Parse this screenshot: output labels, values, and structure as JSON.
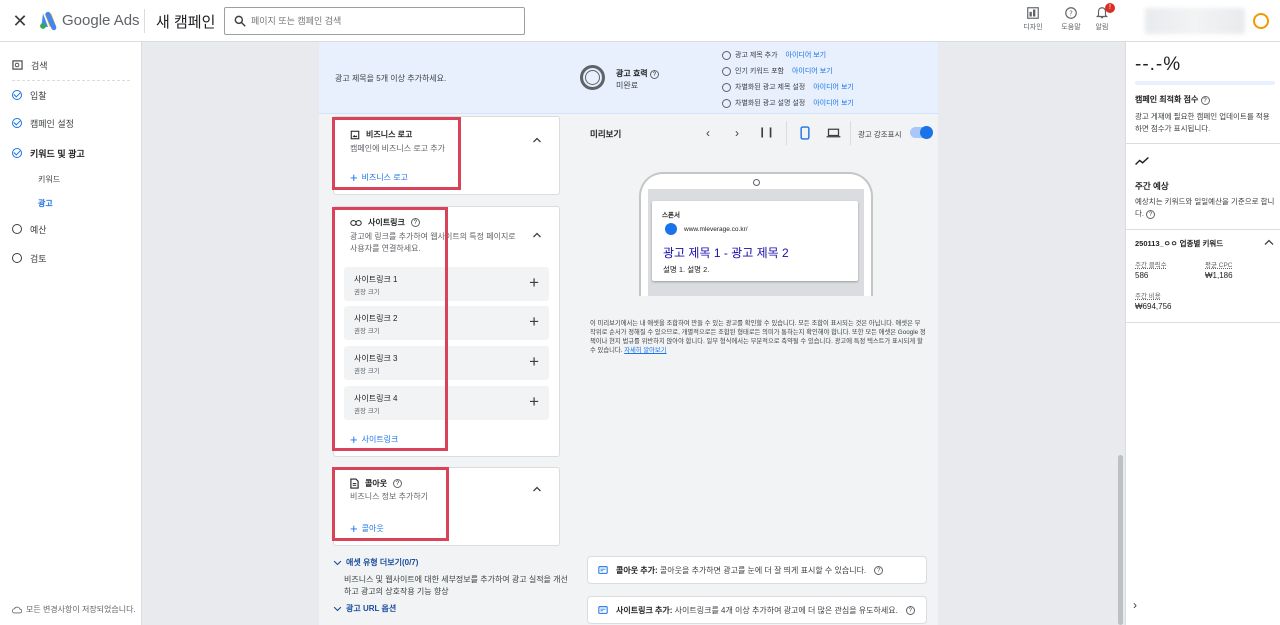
{
  "topbar": {
    "brand": "Google Ads",
    "campaign_title": "새 캠페인",
    "search_placeholder": "페이지 또는 캠페인 검색",
    "design_label": "디자인",
    "help_label": "도움말",
    "notifications_label": "알림",
    "notification_count": "!"
  },
  "leftnav": {
    "items": [
      {
        "label": "검색",
        "state": "icon"
      },
      {
        "label": "입찰",
        "state": "done"
      },
      {
        "label": "캠페인 설정",
        "state": "done"
      },
      {
        "label": "키워드 및 광고",
        "state": "done"
      },
      {
        "label": "예산",
        "state": "todo"
      },
      {
        "label": "검토",
        "state": "todo"
      }
    ],
    "subitems": [
      "키워드",
      "광고"
    ],
    "save_status": "모든 변경사항이 저장되었습니다."
  },
  "strength": {
    "message": "광고 제목을 5개 이상 추가하세요.",
    "label": "광고 효력",
    "value": "미완료",
    "tips": [
      {
        "text": "광고 제목 추가",
        "link": "아이디어 보기"
      },
      {
        "text": "인기 키워드 포함",
        "link": "아이디어 보기"
      },
      {
        "text": "차별화된 광고 제목 설정",
        "link": "아이디어 보기"
      },
      {
        "text": "차별화된 광고 설명 설정",
        "link": "아이디어 보기"
      }
    ]
  },
  "cards": {
    "logo": {
      "title": "비즈니스 로고",
      "subtitle": "캠페인에 비즈니스 로고 추가",
      "add": "비즈니스 로고"
    },
    "sitelink": {
      "title": "사이트링크",
      "subtitle": "광고에 링크를 추가하여 웹사이트의 특정 페이지로 사용자를 연결하세요.",
      "rows": [
        {
          "title": "사이트링크 1",
          "sub": "권장 크기"
        },
        {
          "title": "사이트링크 2",
          "sub": "권장 크기"
        },
        {
          "title": "사이트링크 3",
          "sub": "권장 크기"
        },
        {
          "title": "사이트링크 4",
          "sub": "권장 크기"
        }
      ],
      "add": "사이트링크"
    },
    "callout": {
      "title": "콜아웃",
      "subtitle": "비즈니스 정보 추가하기",
      "add": "콜아웃"
    }
  },
  "more": {
    "asset_types": "애셋 유형 더보기(0/7)",
    "asset_desc": "비즈니스 및 웹사이트에 대한 세부정보를 추가하여 광고 실적을 개선하고 광고의 상호작용 기능 향상",
    "url_options": "광고 URL 옵션"
  },
  "preview": {
    "label": "미리보기",
    "highlight_label": "광고 강조표시",
    "sponsor": "스폰서",
    "url": "www.mleverage.co.kr/",
    "headline": "광고 제목 1 - 광고 제목 2",
    "description": "설명 1. 설명 2.",
    "note": "이 미리보기에서는 내 애셋을 조합하여 만들 수 있는 광고를 확인할 수 있습니다. 모든 조합이 표시되는 것은 아닙니다. 애셋은 무작위로 순서가 정해질 수 있으므로, 개별적으로든 조합된 형태로든 의미가 통하는지 확인해야 합니다. 또한 모든 애셋은 Google 정책이나 현지 법규를 위반하지 않아야 합니다. 일부 형식에서는 부분적으로 축약될 수 있습니다. 광고에 특정 텍스트가 표시되게 할 수 있습니다.",
    "note_link": "자세히 알아보기",
    "tip1_bold": "콜아웃 추가:",
    "tip1_text": "콜아웃을 추가하면 광고를 눈에 더 잘 띄게 표시할 수 있습니다.",
    "tip2_bold": "사이트링크 추가:",
    "tip2_text": "사이트링크를 4개 이상 추가하여 광고에 더 많은 관심을 유도하세요."
  },
  "rightpanel": {
    "score": "--.-%",
    "score_label": "캠페인 최적화 점수",
    "score_desc": "광고 게재에 필요한 캠페인 업데이트를 적용하면 점수가 표시됩니다.",
    "weekly_title": "주간 예상",
    "weekly_desc": "예상치는 키워드와 일일예산을 기준으로 합니다.",
    "keyword_group": "250113_ㅇㅇ 업종별 키워드",
    "stats": [
      {
        "label": "주간 클릭수",
        "value": "586"
      },
      {
        "label": "평균 CPC",
        "value": "₩1,186"
      },
      {
        "label": "주간 비용",
        "value": "₩694,756"
      }
    ]
  },
  "colors": {
    "accent": "#1a73e8",
    "highlight_box": "#d9435a",
    "strength_bg": "#e8f0fe"
  }
}
